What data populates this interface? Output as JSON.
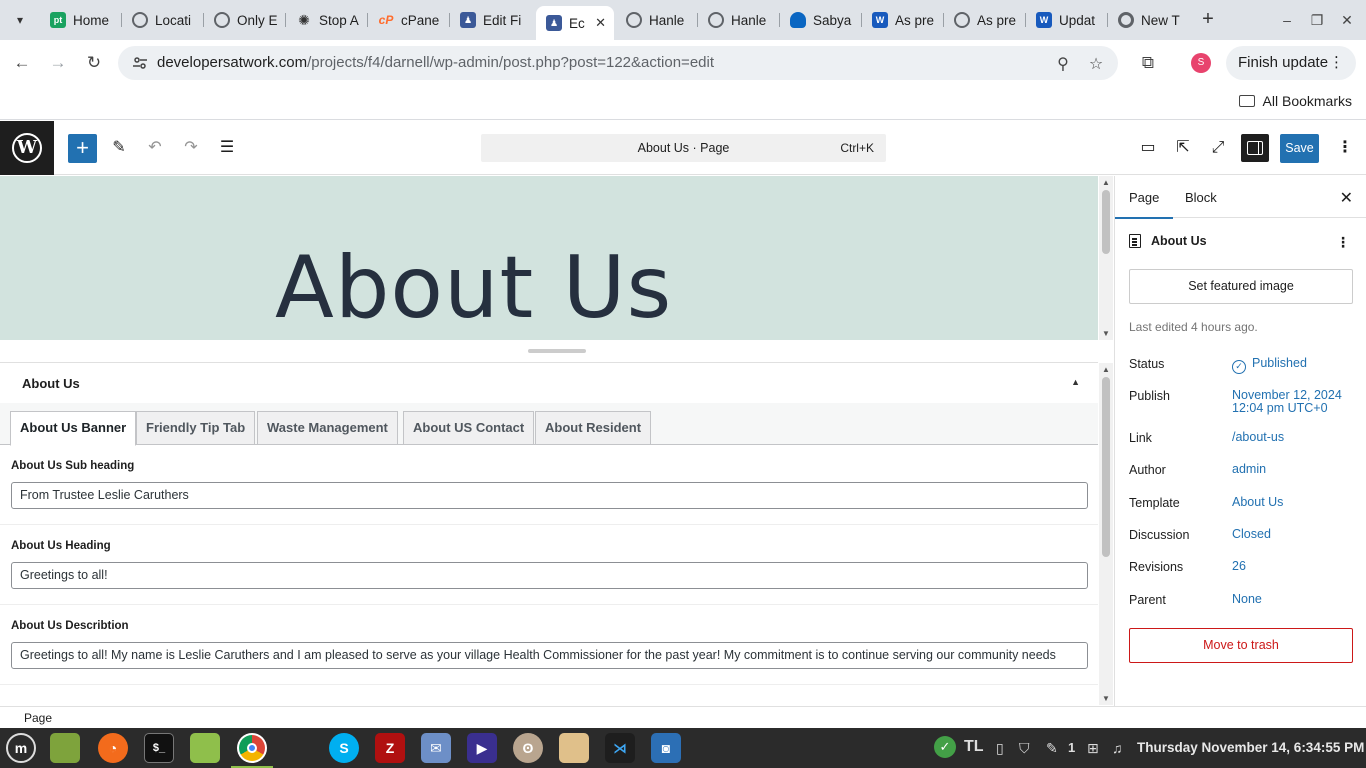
{
  "browser": {
    "tabs": [
      {
        "label": "Home",
        "favicon": "pt",
        "color": "#1aa260"
      },
      {
        "label": "Locati",
        "favicon": "globe",
        "color": "#5f6368"
      },
      {
        "label": "Only E",
        "favicon": "globe",
        "color": "#5f6368"
      },
      {
        "label": "Stop A",
        "favicon": "openai",
        "color": "#333333"
      },
      {
        "label": "cPane",
        "favicon": "cp",
        "color": "#ff6c2c"
      },
      {
        "label": "Edit Fi",
        "favicon": "wp-person",
        "color": "#3b5998"
      },
      {
        "label": "Ec",
        "favicon": "wp-person",
        "color": "#3b5998",
        "active": true
      },
      {
        "label": "Hanle",
        "favicon": "globe",
        "color": "#5f6368"
      },
      {
        "label": "Hanle",
        "favicon": "globe",
        "color": "#5f6368"
      },
      {
        "label": "Sabya",
        "favicon": "cloud",
        "color": "#0a66c2"
      },
      {
        "label": "As pre",
        "favicon": "W",
        "color": "#185abd"
      },
      {
        "label": "As pre",
        "favicon": "globe",
        "color": "#5f6368"
      },
      {
        "label": "Updat",
        "favicon": "W",
        "color": "#185abd"
      },
      {
        "label": "New T",
        "favicon": "chrome",
        "color": "#5f6368"
      }
    ],
    "url_host": "developersatwork.com",
    "url_path": "/projects/f4/darnell/wp-admin/post.php?post=122&action=edit",
    "profile_initial": "S",
    "finish_update": "Finish update",
    "all_bookmarks": "All Bookmarks"
  },
  "editor": {
    "command_title": "About Us · Page",
    "command_shortcut": "Ctrl+K",
    "save_label": "Save",
    "hero_title": "About Us",
    "hero_bg": "#d2e3de",
    "accent": "#2271b1"
  },
  "metabox": {
    "title": "About Us",
    "tabs": [
      "About Us Banner",
      "Friendly Tip Tab",
      "Waste Management",
      "About US Contact",
      "About Resident"
    ],
    "fields": [
      {
        "label": "About Us Sub heading",
        "value": "From Trustee Leslie Caruthers"
      },
      {
        "label": "About Us Heading",
        "value": "Greetings to all!"
      },
      {
        "label": "About Us Describtion",
        "value": "Greetings to all!  My name is Leslie Caruthers and I am pleased to serve as your village Health Commissioner for the past year! My commitment is to continue serving our community needs"
      }
    ]
  },
  "sidebar": {
    "tabs": [
      "Page",
      "Block"
    ],
    "doc_title": "About Us",
    "featured_image": "Set featured image",
    "last_edited": "Last edited 4 hours ago.",
    "rows": [
      {
        "key": "Status",
        "value": "Published"
      },
      {
        "key": "Publish",
        "value": "November 12, 2024",
        "value2": "12:04 pm UTC+0"
      },
      {
        "key": "Link",
        "value": "/about-us"
      },
      {
        "key": "Author",
        "value": "admin"
      },
      {
        "key": "Template",
        "value": "About Us"
      },
      {
        "key": "Discussion",
        "value": "Closed"
      },
      {
        "key": "Revisions",
        "value": "26"
      },
      {
        "key": "Parent",
        "value": "None"
      }
    ],
    "trash": "Move to trash"
  },
  "footer": {
    "breadcrumb": "Page"
  },
  "taskbar": {
    "clock": "Thursday November 14, 6:34:55 PM",
    "tray_count": "1"
  }
}
